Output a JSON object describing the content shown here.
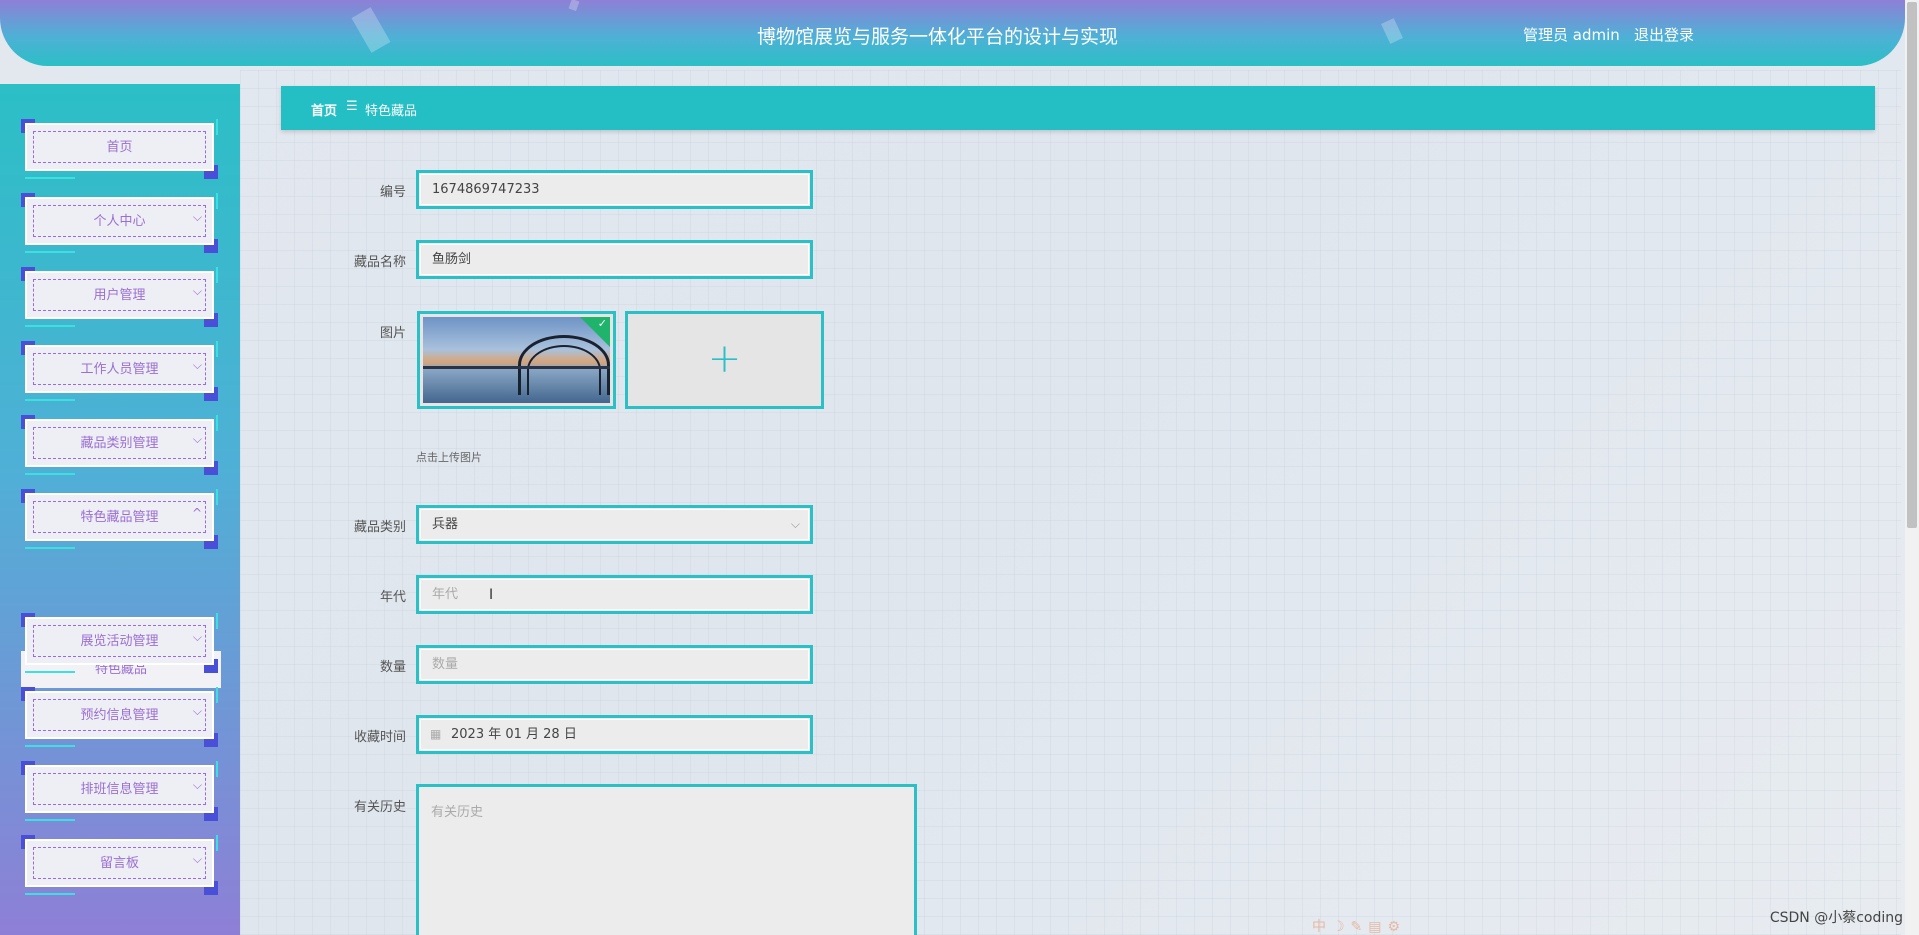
{
  "header": {
    "title": "博物馆展览与服务一体化平台的设计与实现",
    "user": "管理员 admin",
    "logout": "退出登录"
  },
  "sidebar": {
    "items": [
      {
        "label": "首页",
        "chevron": ""
      },
      {
        "label": "个人中心",
        "chevron": "⌵"
      },
      {
        "label": "用户管理",
        "chevron": "⌵"
      },
      {
        "label": "工作人员管理",
        "chevron": "⌵"
      },
      {
        "label": "藏品类别管理",
        "chevron": "⌵"
      },
      {
        "label": "特色藏品管理",
        "chevron": "^"
      },
      {
        "label": "展览活动管理",
        "chevron": "⌵"
      },
      {
        "label": "预约信息管理",
        "chevron": "⌵"
      },
      {
        "label": "排班信息管理",
        "chevron": "⌵"
      },
      {
        "label": "留言板",
        "chevron": "⌵"
      }
    ],
    "submenu": {
      "label": "特色藏品"
    }
  },
  "breadcrumb": {
    "home": "首页",
    "separator": "☰",
    "current": "特色藏品"
  },
  "form": {
    "number": {
      "label": "编号",
      "value": "1674869747233"
    },
    "name": {
      "label": "藏品名称",
      "value": "鱼肠剑"
    },
    "image": {
      "label": "图片",
      "hint": "点击上传图片"
    },
    "category": {
      "label": "藏品类别",
      "value": "兵器"
    },
    "era": {
      "label": "年代",
      "placeholder": "年代"
    },
    "quantity": {
      "label": "数量",
      "placeholder": "数量"
    },
    "collect_time": {
      "label": "收藏时间",
      "value": "2023 年 01 月 28 日"
    },
    "history": {
      "label": "有关历史",
      "placeholder": "有关历史"
    }
  },
  "watermark": "CSDN @小蔡coding",
  "colors": {
    "accent": "#2bbfc6",
    "menu_text": "#9b6fd1",
    "corner": "#4a4fd8"
  }
}
